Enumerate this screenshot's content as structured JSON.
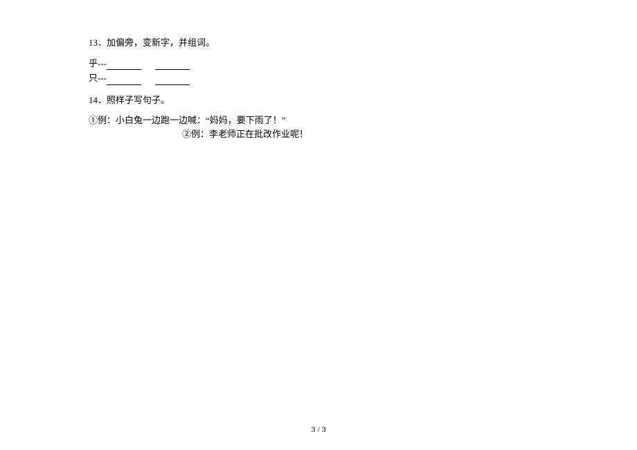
{
  "q13": {
    "label": "13．加偏旁，变新字，并组词。",
    "rows": [
      {
        "char": "乎",
        "sep": "---"
      },
      {
        "char": "只",
        "sep": "---"
      }
    ]
  },
  "q14": {
    "label": "14．照样子写句子。",
    "example1": "①例：小白兔一边跑一边喊：“妈妈，要下雨了！”",
    "example2": "②例：李老师正在批改作业呢！"
  },
  "footer": {
    "page": "3 / 3"
  }
}
